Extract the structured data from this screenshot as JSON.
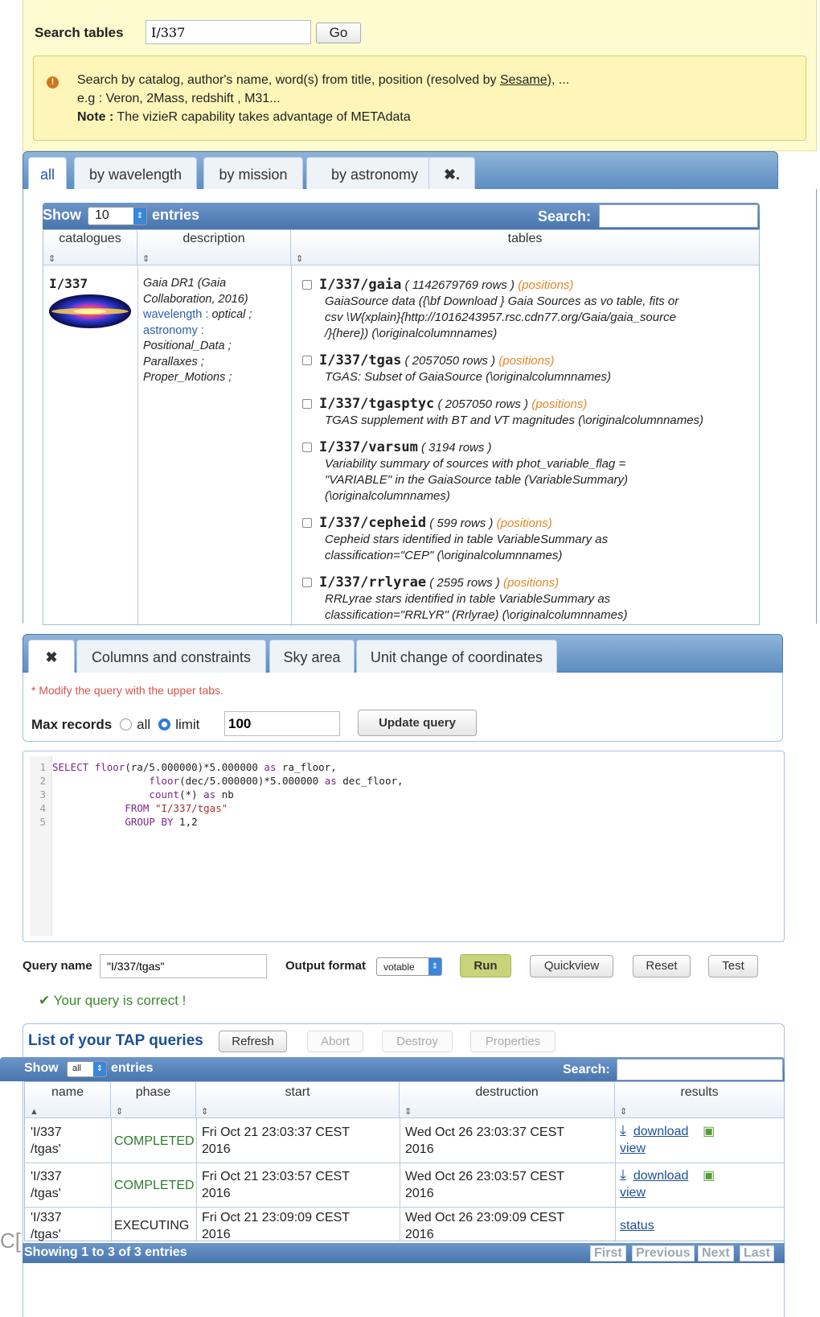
{
  "search": {
    "label": "Search tables",
    "value": "I/337",
    "go": "Go"
  },
  "note": {
    "line1_prefix": "Search by catalog, author's name, word(s) from title, position (resolved by ",
    "line1_link": "Sesame",
    "line1_suffix": "), ...",
    "line2": "e.g : Veron, 2Mass, redshift , M31...",
    "line3_bold": "Note :",
    "line3": " The vizieR capability takes advantage of METAdata",
    "icon": "info-icon"
  },
  "tabs1": [
    {
      "label": "all"
    },
    {
      "label": "by wavelength"
    },
    {
      "label": "by mission"
    },
    {
      "label": "by astronomy"
    },
    {
      "label": "✖."
    }
  ],
  "catalog_table": {
    "show": "Show",
    "entries_value": "10",
    "entries": "entries",
    "search_label": "Search:",
    "headers": [
      "catalogues",
      "description",
      "tables"
    ],
    "catalog": {
      "id": "I/337",
      "desc_title": "Gaia DR1 (Gaia Collaboration, 2016)",
      "wavelength_label": "wavelength :",
      "wavelength_val": "optical ;",
      "astronomy_label": "astronomy :",
      "astronomy_val1": "Positional_Data ;",
      "astronomy_val2": "Parallaxes ;",
      "astronomy_val3": "Proper_Motions ;"
    },
    "tables": [
      {
        "name": "I/337/gaia",
        "rows": "( 1142679769 rows )",
        "pos": "(positions)",
        "desc": [
          "GaiaSource data ({\\bf Download } Gaia Sources as vo table, fits or",
          "csv \\W{xplain}{http://1016243957.rsc.cdn77.org/Gaia/gaia_source",
          "/}{here}) (\\originalcolumnnames)"
        ]
      },
      {
        "name": "I/337/tgas",
        "rows": "( 2057050 rows )",
        "pos": "(positions)",
        "desc": [
          "TGAS: Subset of GaiaSource  (\\originalcolumnnames)"
        ]
      },
      {
        "name": "I/337/tgasptyc",
        "rows": "( 2057050 rows )",
        "pos": "(positions)",
        "desc": [
          "TGAS supplement with BT and VT magnitudes (\\originalcolumnnames)"
        ]
      },
      {
        "name": "I/337/varsum",
        "rows": "( 3194 rows )",
        "pos": "",
        "desc": [
          "Variability summary of sources with phot_variable_flag =",
          "\"VARIABLE\" in the GaiaSource table (VariableSummary)",
          "(\\originalcolumnnames)"
        ]
      },
      {
        "name": "I/337/cepheid",
        "rows": "( 599 rows )",
        "pos": "(positions)",
        "desc": [
          "Cepheid stars identified in table VariableSummary as",
          "classification=\"CEP\" (\\originalcolumnnames)"
        ]
      },
      {
        "name": "I/337/rrlyrae",
        "rows": "( 2595 rows )",
        "pos": "(positions)",
        "desc": [
          "RRLyrae stars identified in table VariableSummary as",
          "classification=\"RRLYR\" (Rrlyrae) (\\originalcolumnnames)"
        ]
      }
    ]
  },
  "tabs2": [
    {
      "label": "✖"
    },
    {
      "label": "Columns and constraints"
    },
    {
      "label": "Sky area"
    },
    {
      "label": "Unit change of coordinates"
    }
  ],
  "query": {
    "modify_note": "* Modify the query with the upper tabs.",
    "max_records": "Max records",
    "all": "all",
    "limit": "limit",
    "limit_value": "100",
    "update": "Update query"
  },
  "code": [
    {
      "n": "1",
      "parts": [
        [
          "kw",
          "SELECT "
        ],
        [
          "",
          ""
        ],
        [
          "kw",
          "floor"
        ],
        [
          "",
          "(ra/5.000000)*5.000000 "
        ],
        [
          "kw",
          "as"
        ],
        [
          "",
          " ra_floor,"
        ]
      ]
    },
    {
      "n": "2",
      "parts": [
        [
          "",
          "                "
        ],
        [
          "kw",
          "floor"
        ],
        [
          "",
          "(dec/5.000000)*5.000000 "
        ],
        [
          "kw",
          "as"
        ],
        [
          "",
          " dec_floor,"
        ]
      ]
    },
    {
      "n": "3",
      "parts": [
        [
          "",
          "                "
        ],
        [
          "kw",
          "count"
        ],
        [
          "",
          "(*) "
        ],
        [
          "kw",
          "as"
        ],
        [
          "",
          " nb"
        ]
      ]
    },
    {
      "n": "4",
      "parts": [
        [
          "",
          "            "
        ],
        [
          "kw",
          "FROM "
        ],
        [
          "str",
          "\"I/337/tgas\""
        ]
      ]
    },
    {
      "n": "5",
      "parts": [
        [
          "",
          "            "
        ],
        [
          "kw",
          "GROUP BY "
        ],
        [
          "",
          "1,2"
        ]
      ]
    }
  ],
  "runbar": {
    "query_name_label": "Query name",
    "query_name_value": "\"I/337/tgas\"",
    "output_label": "Output format",
    "output_value": "votable",
    "run": "Run",
    "quickview": "Quickview",
    "reset": "Reset",
    "test": "Test"
  },
  "status_msg": "Your query is correct !",
  "tap": {
    "title": "List of your TAP queries",
    "buttons": {
      "refresh": "Refresh",
      "abort": "Abort",
      "destroy": "Destroy",
      "properties": "Properties"
    },
    "show": "Show",
    "entries_value": "all",
    "entries": "entries",
    "search_label": "Search:",
    "headers": [
      "name",
      "phase",
      "start",
      "destruction",
      "results"
    ],
    "rows": [
      {
        "name1": "'I/337",
        "name2": "/tgas'",
        "phase": "COMPLETED",
        "start1": "Fri Oct 21 23:03:37 CEST",
        "start2": "2016",
        "dest1": "Wed Oct 26 23:03:37 CEST",
        "dest2": "2016",
        "r1": "download",
        "r2": "view"
      },
      {
        "name1": "'I/337",
        "name2": "/tgas'",
        "phase": "COMPLETED",
        "start1": "Fri Oct 21 23:03:57 CEST",
        "start2": "2016",
        "dest1": "Wed Oct 26 23:03:57 CEST",
        "dest2": "2016",
        "r1": "download",
        "r2": "view"
      },
      {
        "name1": "'I/337",
        "name2": "/tgas'",
        "phase": "EXECUTING",
        "start1": "Fri Oct 21 23:09:09 CEST",
        "start2": "2016",
        "dest1": "Wed Oct 26 23:09:09 CEST",
        "dest2": "2016",
        "r1": "status",
        "r2": ""
      }
    ],
    "footer": "Showing 1 to 3 of 3 entries",
    "pager": [
      "First",
      "Previous",
      "Next",
      "Last"
    ]
  },
  "left_fragment": "C["
}
